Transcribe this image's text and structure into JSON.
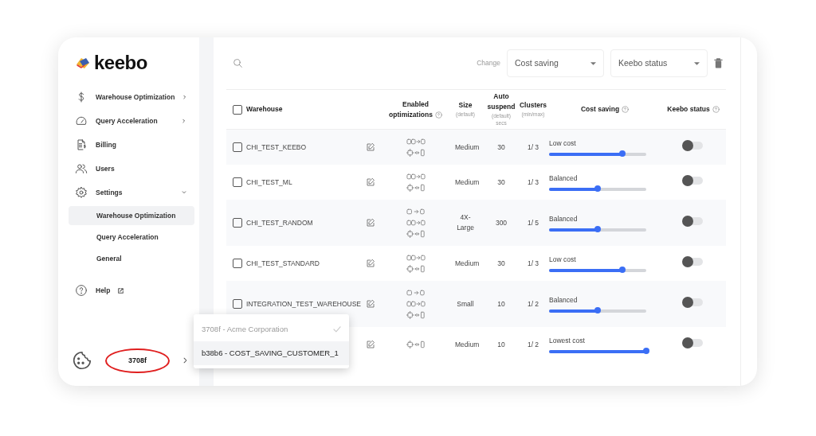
{
  "sidebar": {
    "logo": "keebo",
    "items": [
      {
        "label": "Warehouse Optimization",
        "expanded": false
      },
      {
        "label": "Query Acceleration",
        "expanded": false
      },
      {
        "label": "Billing"
      },
      {
        "label": "Users"
      },
      {
        "label": "Settings",
        "expanded": true,
        "children": [
          {
            "label": "Warehouse Optimization",
            "selected": true
          },
          {
            "label": "Query Acceleration",
            "selected": false
          },
          {
            "label": "General",
            "selected": false
          }
        ]
      },
      {
        "label": "Help",
        "external": true
      }
    ],
    "account": "3708f"
  },
  "account_menu": [
    {
      "label": "3708f - Acme Corporation",
      "selected": true
    },
    {
      "label": "b38b6 - COST_SAVING_CUSTOMER_1",
      "selected": false
    }
  ],
  "toolbar": {
    "change_label": "Change",
    "selects": [
      {
        "value": "Cost saving"
      },
      {
        "value": "Keebo status"
      }
    ]
  },
  "table": {
    "select_all_checked": false,
    "columns": [
      {
        "label": "Warehouse"
      },
      {
        "label": "Enabled optimizations",
        "help": true
      },
      {
        "label": "Size",
        "notes": [
          "(default)"
        ]
      },
      {
        "label": "Auto suspend",
        "notes": [
          "(default)",
          "secs"
        ]
      },
      {
        "label": "Clusters",
        "notes": [
          "(min/max)"
        ]
      },
      {
        "label": "Cost saving",
        "help": true
      },
      {
        "label": "Keebo status",
        "help": true
      }
    ],
    "rows": [
      {
        "name": "CHI_TEST_KEEBO",
        "checked": false,
        "optimizations": [
          {
            "kind": "merge"
          },
          {
            "kind": "resize"
          }
        ],
        "size": "Medium",
        "auto_suspend": "30",
        "clusters": "1/ 3",
        "cost_saving": "Low cost",
        "level": 0.75,
        "keebo_on": false
      },
      {
        "name": "CHI_TEST_ML",
        "checked": false,
        "optimizations": [
          {
            "kind": "merge"
          },
          {
            "kind": "resize"
          }
        ],
        "size": "Medium",
        "auto_suspend": "30",
        "clusters": "1/ 3",
        "cost_saving": "Balanced",
        "level": 0.5,
        "keebo_on": false
      },
      {
        "name": "CHI_TEST_RANDOM",
        "checked": false,
        "optimizations": [
          {
            "kind": "move"
          },
          {
            "kind": "merge"
          },
          {
            "kind": "resize"
          }
        ],
        "size": "4X-Large",
        "auto_suspend": "300",
        "clusters": "1/ 5",
        "cost_saving": "Balanced",
        "level": 0.5,
        "keebo_on": false
      },
      {
        "name": "CHI_TEST_STANDARD",
        "checked": false,
        "optimizations": [
          {
            "kind": "merge"
          },
          {
            "kind": "resize"
          }
        ],
        "size": "Medium",
        "auto_suspend": "30",
        "clusters": "1/ 3",
        "cost_saving": "Low cost",
        "level": 0.75,
        "keebo_on": false
      },
      {
        "name": "INTEGRATION_TEST_WAREHOUSE",
        "checked": false,
        "optimizations": [
          {
            "kind": "move"
          },
          {
            "kind": "merge"
          },
          {
            "kind": "resize"
          }
        ],
        "size": "Small",
        "auto_suspend": "10",
        "clusters": "1/ 2",
        "cost_saving": "Balanced",
        "level": 0.5,
        "keebo_on": false
      },
      {
        "optimizations": [
          {
            "kind": "resize"
          }
        ],
        "size": "Medium",
        "auto_suspend": "10",
        "clusters": "1/ 2",
        "cost_saving": "Lowest cost",
        "level": 1,
        "keebo_on": false
      }
    ]
  }
}
